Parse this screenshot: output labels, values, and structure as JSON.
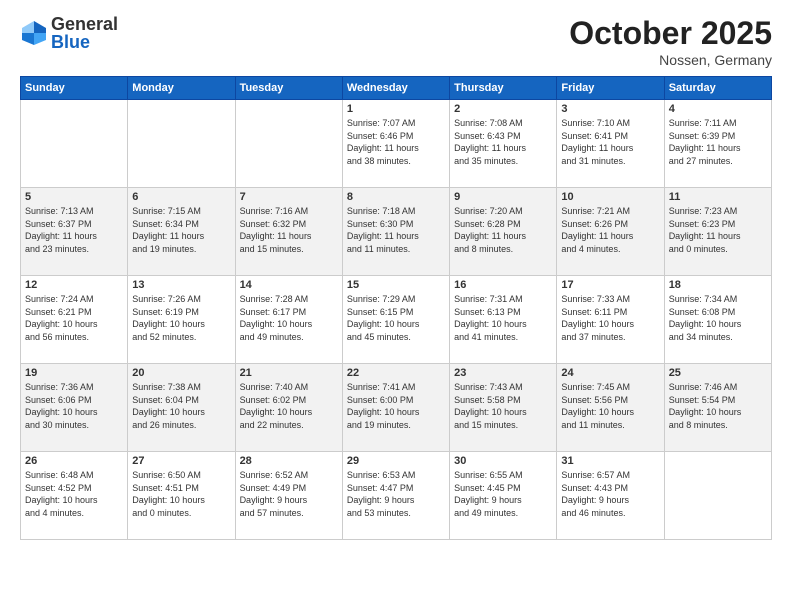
{
  "logo": {
    "general": "General",
    "blue": "Blue"
  },
  "header": {
    "month": "October 2025",
    "location": "Nossen, Germany"
  },
  "weekdays": [
    "Sunday",
    "Monday",
    "Tuesday",
    "Wednesday",
    "Thursday",
    "Friday",
    "Saturday"
  ],
  "weeks": [
    [
      {
        "day": "",
        "info": ""
      },
      {
        "day": "",
        "info": ""
      },
      {
        "day": "",
        "info": ""
      },
      {
        "day": "1",
        "info": "Sunrise: 7:07 AM\nSunset: 6:46 PM\nDaylight: 11 hours\nand 38 minutes."
      },
      {
        "day": "2",
        "info": "Sunrise: 7:08 AM\nSunset: 6:43 PM\nDaylight: 11 hours\nand 35 minutes."
      },
      {
        "day": "3",
        "info": "Sunrise: 7:10 AM\nSunset: 6:41 PM\nDaylight: 11 hours\nand 31 minutes."
      },
      {
        "day": "4",
        "info": "Sunrise: 7:11 AM\nSunset: 6:39 PM\nDaylight: 11 hours\nand 27 minutes."
      }
    ],
    [
      {
        "day": "5",
        "info": "Sunrise: 7:13 AM\nSunset: 6:37 PM\nDaylight: 11 hours\nand 23 minutes."
      },
      {
        "day": "6",
        "info": "Sunrise: 7:15 AM\nSunset: 6:34 PM\nDaylight: 11 hours\nand 19 minutes."
      },
      {
        "day": "7",
        "info": "Sunrise: 7:16 AM\nSunset: 6:32 PM\nDaylight: 11 hours\nand 15 minutes."
      },
      {
        "day": "8",
        "info": "Sunrise: 7:18 AM\nSunset: 6:30 PM\nDaylight: 11 hours\nand 11 minutes."
      },
      {
        "day": "9",
        "info": "Sunrise: 7:20 AM\nSunset: 6:28 PM\nDaylight: 11 hours\nand 8 minutes."
      },
      {
        "day": "10",
        "info": "Sunrise: 7:21 AM\nSunset: 6:26 PM\nDaylight: 11 hours\nand 4 minutes."
      },
      {
        "day": "11",
        "info": "Sunrise: 7:23 AM\nSunset: 6:23 PM\nDaylight: 11 hours\nand 0 minutes."
      }
    ],
    [
      {
        "day": "12",
        "info": "Sunrise: 7:24 AM\nSunset: 6:21 PM\nDaylight: 10 hours\nand 56 minutes."
      },
      {
        "day": "13",
        "info": "Sunrise: 7:26 AM\nSunset: 6:19 PM\nDaylight: 10 hours\nand 52 minutes."
      },
      {
        "day": "14",
        "info": "Sunrise: 7:28 AM\nSunset: 6:17 PM\nDaylight: 10 hours\nand 49 minutes."
      },
      {
        "day": "15",
        "info": "Sunrise: 7:29 AM\nSunset: 6:15 PM\nDaylight: 10 hours\nand 45 minutes."
      },
      {
        "day": "16",
        "info": "Sunrise: 7:31 AM\nSunset: 6:13 PM\nDaylight: 10 hours\nand 41 minutes."
      },
      {
        "day": "17",
        "info": "Sunrise: 7:33 AM\nSunset: 6:11 PM\nDaylight: 10 hours\nand 37 minutes."
      },
      {
        "day": "18",
        "info": "Sunrise: 7:34 AM\nSunset: 6:08 PM\nDaylight: 10 hours\nand 34 minutes."
      }
    ],
    [
      {
        "day": "19",
        "info": "Sunrise: 7:36 AM\nSunset: 6:06 PM\nDaylight: 10 hours\nand 30 minutes."
      },
      {
        "day": "20",
        "info": "Sunrise: 7:38 AM\nSunset: 6:04 PM\nDaylight: 10 hours\nand 26 minutes."
      },
      {
        "day": "21",
        "info": "Sunrise: 7:40 AM\nSunset: 6:02 PM\nDaylight: 10 hours\nand 22 minutes."
      },
      {
        "day": "22",
        "info": "Sunrise: 7:41 AM\nSunset: 6:00 PM\nDaylight: 10 hours\nand 19 minutes."
      },
      {
        "day": "23",
        "info": "Sunrise: 7:43 AM\nSunset: 5:58 PM\nDaylight: 10 hours\nand 15 minutes."
      },
      {
        "day": "24",
        "info": "Sunrise: 7:45 AM\nSunset: 5:56 PM\nDaylight: 10 hours\nand 11 minutes."
      },
      {
        "day": "25",
        "info": "Sunrise: 7:46 AM\nSunset: 5:54 PM\nDaylight: 10 hours\nand 8 minutes."
      }
    ],
    [
      {
        "day": "26",
        "info": "Sunrise: 6:48 AM\nSunset: 4:52 PM\nDaylight: 10 hours\nand 4 minutes."
      },
      {
        "day": "27",
        "info": "Sunrise: 6:50 AM\nSunset: 4:51 PM\nDaylight: 10 hours\nand 0 minutes."
      },
      {
        "day": "28",
        "info": "Sunrise: 6:52 AM\nSunset: 4:49 PM\nDaylight: 9 hours\nand 57 minutes."
      },
      {
        "day": "29",
        "info": "Sunrise: 6:53 AM\nSunset: 4:47 PM\nDaylight: 9 hours\nand 53 minutes."
      },
      {
        "day": "30",
        "info": "Sunrise: 6:55 AM\nSunset: 4:45 PM\nDaylight: 9 hours\nand 49 minutes."
      },
      {
        "day": "31",
        "info": "Sunrise: 6:57 AM\nSunset: 4:43 PM\nDaylight: 9 hours\nand 46 minutes."
      },
      {
        "day": "",
        "info": ""
      }
    ]
  ]
}
